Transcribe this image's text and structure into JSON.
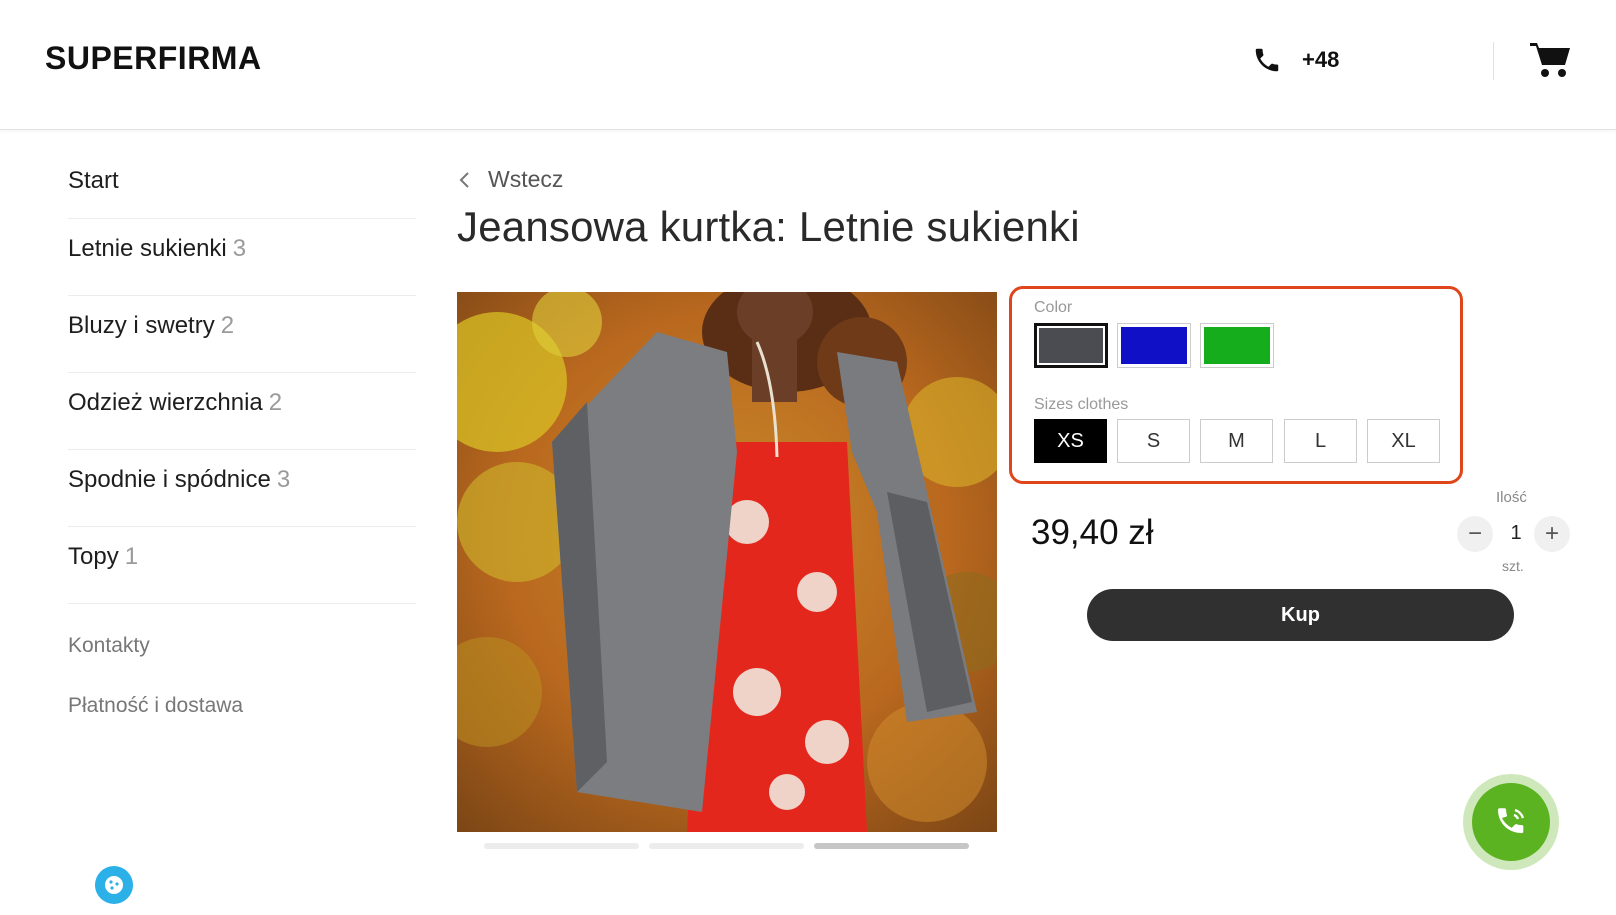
{
  "header": {
    "logo": "SUPERFIRMA",
    "phone": "+48",
    "phone_icon": "phone-icon",
    "cart_icon": "cart-icon"
  },
  "sidebar": {
    "start": "Start",
    "categories": [
      {
        "label": "Letnie sukienki",
        "count": "3"
      },
      {
        "label": "Bluzy i swetry",
        "count": "2"
      },
      {
        "label": "Odzież wierzchnia",
        "count": "2"
      },
      {
        "label": "Spodnie i spódnice",
        "count": "3"
      },
      {
        "label": "Topy",
        "count": "1"
      }
    ],
    "links": [
      "Kontakty",
      "Płatność i dostawa"
    ]
  },
  "product": {
    "back_label": "Wstecz",
    "title": "Jeansowa kurtka: Letnie sukienki",
    "gallery": {
      "slides": 3,
      "active_slide": 3
    },
    "color_label": "Color",
    "colors": [
      {
        "name": "gray",
        "hex": "#4a4c52",
        "selected": true
      },
      {
        "name": "blue",
        "hex": "#1010c6",
        "selected": false
      },
      {
        "name": "green",
        "hex": "#16ad1c",
        "selected": false
      }
    ],
    "sizes_label": "Sizes clothes",
    "sizes": [
      "XS",
      "S",
      "M",
      "L",
      "XL"
    ],
    "selected_size": "XS",
    "price": "39,40 zł",
    "qty_label": "Ilość",
    "qty_value": "1",
    "qty_unit": "szt.",
    "qty_minus": "−",
    "qty_plus": "+",
    "buy_label": "Kup"
  },
  "colors": {
    "highlight_border": "#e0461b",
    "buy_button": "#303030",
    "call_button": "#5cb321",
    "cookie_button": "#2bb0e8"
  }
}
